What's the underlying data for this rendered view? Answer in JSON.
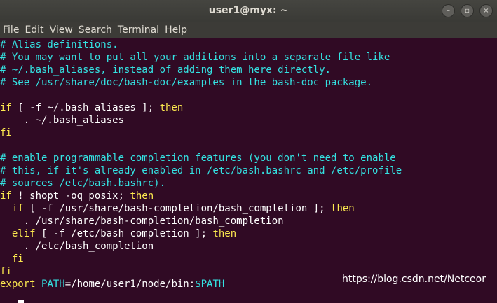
{
  "window": {
    "title": "user1@myx: ~",
    "controls": [
      "–",
      "▫",
      "×"
    ]
  },
  "menubar": {
    "items": [
      "File",
      "Edit",
      "View",
      "Search",
      "Terminal",
      "Help"
    ]
  },
  "terminal": {
    "lines": [
      [
        [
          "cm",
          "# Alias definitions."
        ]
      ],
      [
        [
          "cm",
          "# You may want to put all your additions into a separate file like"
        ]
      ],
      [
        [
          "cm",
          "# ~/.bash_aliases, instead of adding them here directly."
        ]
      ],
      [
        [
          "cm",
          "# See /usr/share/doc/bash-doc/examples in the bash-doc package."
        ]
      ],
      [],
      [
        [
          "kw",
          "if"
        ],
        [
          "tx",
          " [ -f ~/.bash_aliases ]; "
        ],
        [
          "kw",
          "then"
        ]
      ],
      [
        [
          "tx",
          "    . ~/.bash_aliases"
        ]
      ],
      [
        [
          "kw",
          "fi"
        ]
      ],
      [],
      [
        [
          "cm",
          "# enable programmable completion features (you don't need to enable"
        ]
      ],
      [
        [
          "cm",
          "# this, if it's already enabled in /etc/bash.bashrc and /etc/profile"
        ]
      ],
      [
        [
          "cm",
          "# sources /etc/bash.bashrc)."
        ]
      ],
      [
        [
          "kw",
          "if"
        ],
        [
          "tx",
          " ! shopt -oq posix; "
        ],
        [
          "kw",
          "then"
        ]
      ],
      [
        [
          "tx",
          "  "
        ],
        [
          "kw",
          "if"
        ],
        [
          "tx",
          " [ -f /usr/share/bash-completion/bash_completion ]; "
        ],
        [
          "kw",
          "then"
        ]
      ],
      [
        [
          "tx",
          "    . /usr/share/bash-completion/bash_completion"
        ]
      ],
      [
        [
          "tx",
          "  "
        ],
        [
          "kw",
          "elif"
        ],
        [
          "tx",
          " [ -f /etc/bash_completion ]; "
        ],
        [
          "kw",
          "then"
        ]
      ],
      [
        [
          "tx",
          "    . /etc/bash_completion"
        ]
      ],
      [
        [
          "tx",
          "  "
        ],
        [
          "kw",
          "fi"
        ]
      ],
      [
        [
          "kw",
          "fi"
        ]
      ],
      [
        [
          "kw",
          "export"
        ],
        [
          "tx",
          " "
        ],
        [
          "vr",
          "PATH"
        ],
        [
          "tx",
          "=/home/user1/node/bin:"
        ],
        [
          "vr",
          "$PATH"
        ]
      ]
    ],
    "colors": {
      "background": "#300a24",
      "comment": "#34e2e2",
      "keyword": "#fce94f",
      "text": "#ffffff"
    }
  },
  "watermark": "https://blog.csdn.net/Netceor"
}
